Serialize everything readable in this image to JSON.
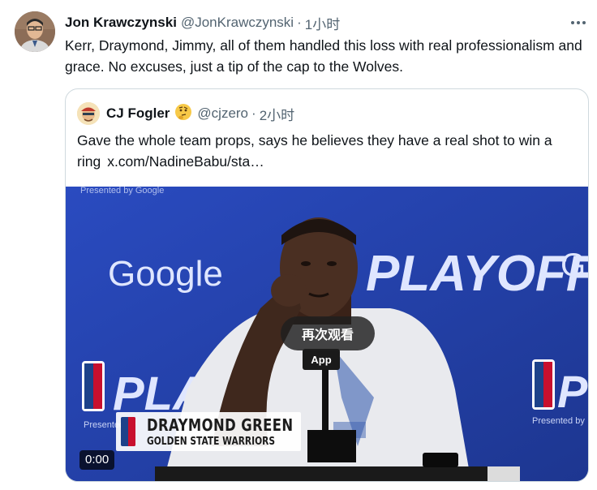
{
  "tweet": {
    "author_name": "Jon Krawczynski",
    "author_handle": "@JonKrawczynski",
    "separator": "·",
    "time": "1小时",
    "text": "Kerr, Draymond, Jimmy, all of them handled this loss with real professionalism and grace. No excuses, just a tip of the cap to the Wolves."
  },
  "quote": {
    "author_name": "CJ Fogler",
    "author_emoji": "🤔",
    "author_handle": "@cjzero",
    "separator": "·",
    "time": "2小时",
    "text": "Gave the whole team props, says he believes they have a real shot to win a ring",
    "link": "x.com/NadineBabu/sta…"
  },
  "video": {
    "replay_label": "再次观看",
    "timecode": "0:00",
    "sponsor_text": "Google",
    "sponsor_top_text": "Presented by Google",
    "backdrop_text": "PLAYOFFS",
    "backdrop_text_left": "PLAY",
    "backdrop_text_right": "PL",
    "presented_text": "Presented by",
    "lower_third_name": "DRAYMOND GREEN",
    "lower_third_team": "GOLDEN STATE WARRIORS",
    "mic_tag": "App",
    "colors": {
      "backdrop": "#243fa8",
      "shirt": "#e9eaee",
      "skin": "#4a2f22"
    }
  },
  "icons": {
    "more": "more-horizontal-icon"
  }
}
